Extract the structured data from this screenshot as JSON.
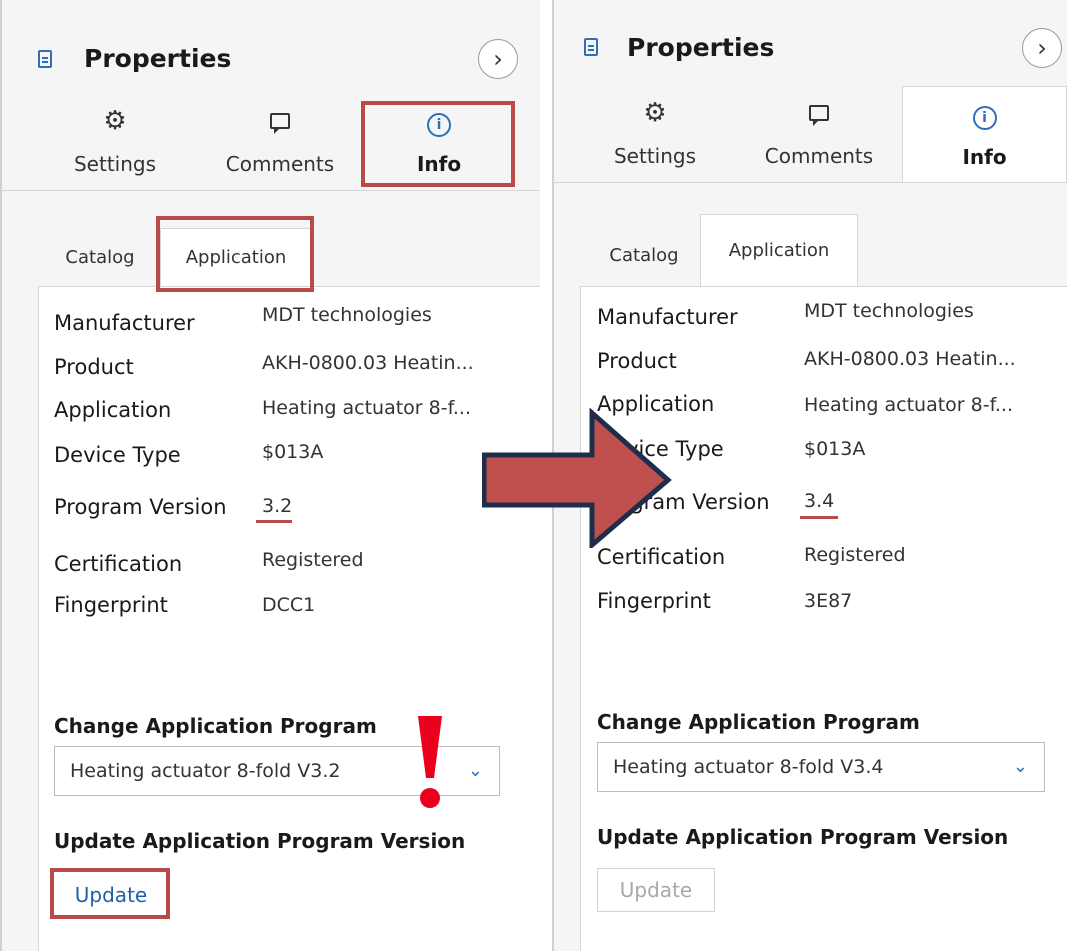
{
  "colors": {
    "accent": "#2f6fb7",
    "highlight": "#b84a4a",
    "arrow_fill": "#c0504d",
    "arrow_stroke": "#1f2d4d",
    "warning": "#e8001c"
  },
  "panels": [
    {
      "header": {
        "title": "Properties",
        "icon": "document-icon",
        "collapse_icon": "chevron-right-icon",
        "collapse_glyph": "›"
      },
      "tabs": [
        {
          "label": "Settings",
          "icon": "gear-icon",
          "glyph": "⚙"
        },
        {
          "label": "Comments",
          "icon": "comment-icon"
        },
        {
          "label": "Info",
          "icon": "info-icon",
          "glyph": "i",
          "active": true
        }
      ],
      "subtabs": [
        {
          "label": "Catalog"
        },
        {
          "label": "Application",
          "active": true
        }
      ],
      "props": [
        {
          "label": "Manufacturer",
          "value": "MDT technologies"
        },
        {
          "label": "Product",
          "value": "AKH-0800.03 Heatin..."
        },
        {
          "label": "Application",
          "value": "Heating actuator 8-f..."
        },
        {
          "label": "Device Type",
          "value": "$013A"
        },
        {
          "label": "Program Version",
          "value": "3.2"
        },
        {
          "label": "Certification",
          "value": "Registered"
        },
        {
          "label": "Fingerprint",
          "value": "DCC1"
        }
      ],
      "change_program": {
        "title": "Change Application Program",
        "selected": "Heating actuator 8-fold V3.2",
        "chevron": "⌄"
      },
      "update_section": {
        "title": "Update Application Program Version",
        "button": "Update",
        "enabled": true
      }
    },
    {
      "header": {
        "title": "Properties",
        "icon": "document-icon",
        "collapse_icon": "chevron-right-icon",
        "collapse_glyph": "›"
      },
      "tabs": [
        {
          "label": "Settings",
          "icon": "gear-icon",
          "glyph": "⚙"
        },
        {
          "label": "Comments",
          "icon": "comment-icon"
        },
        {
          "label": "Info",
          "icon": "info-icon",
          "glyph": "i",
          "active": true
        }
      ],
      "subtabs": [
        {
          "label": "Catalog"
        },
        {
          "label": "Application",
          "active": true
        }
      ],
      "props": [
        {
          "label": "Manufacturer",
          "value": "MDT technologies"
        },
        {
          "label": "Product",
          "value": "AKH-0800.03 Heatin..."
        },
        {
          "label": "Application",
          "value": "Heating actuator 8-f..."
        },
        {
          "label": "Device Type",
          "value": "$013A"
        },
        {
          "label": "Program Version",
          "value": "3.4"
        },
        {
          "label": "Certification",
          "value": "Registered"
        },
        {
          "label": "Fingerprint",
          "value": "3E87"
        }
      ],
      "change_program": {
        "title": "Change Application Program",
        "selected": "Heating actuator 8-fold V3.4",
        "chevron": "⌄"
      },
      "update_section": {
        "title": "Update Application Program Version",
        "button": "Update",
        "enabled": false
      }
    }
  ],
  "annotations": {
    "arrow_icon": "right-arrow-icon",
    "warning_icon": "exclamation-icon"
  }
}
